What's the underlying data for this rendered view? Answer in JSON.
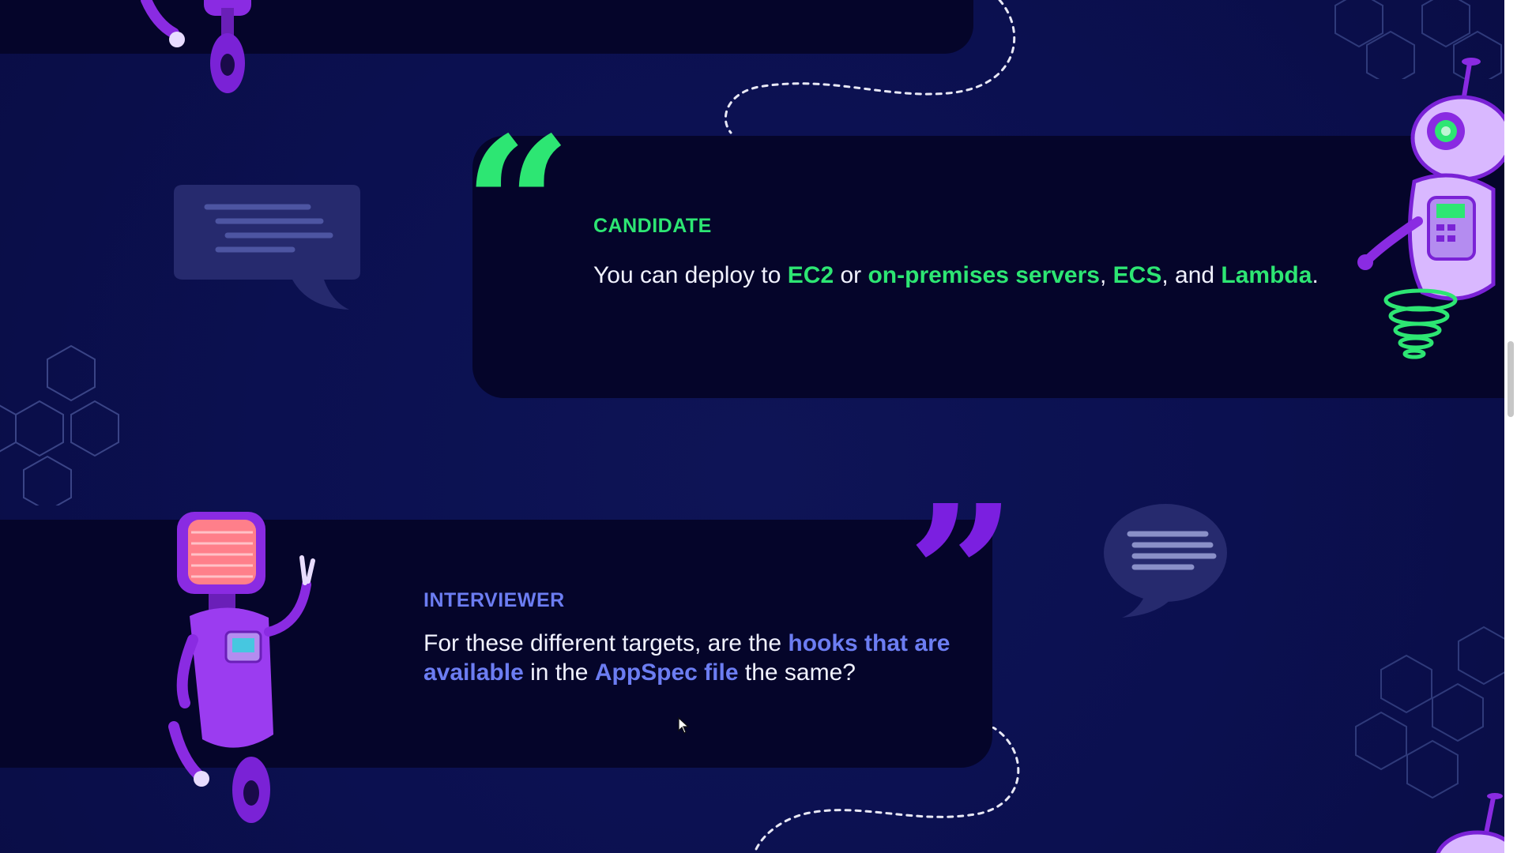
{
  "conversation": {
    "candidate": {
      "role_label": "CANDIDATE",
      "message": {
        "t1": "You can deploy to ",
        "h1": "EC2",
        "t2": " or ",
        "h2": "on-premises servers",
        "t3": ", ",
        "h3": "ECS",
        "t4": ", and ",
        "h4": "Lambda",
        "t5": "."
      }
    },
    "interviewer": {
      "role_label": "INTERVIEWER",
      "message": {
        "t1": "For these different targets, are the ",
        "h1": "hooks that are available",
        "t2": " in the ",
        "h2": "AppSpec file",
        "t3": " the same?"
      }
    }
  },
  "quotes": {
    "open": "“",
    "close": "”"
  },
  "colors": {
    "background": "#0b1050",
    "card": "#05052a",
    "candidate_accent": "#2de673",
    "interviewer_accent": "#6c7df2",
    "robot_purple": "#8a2be2",
    "text": "#f1f2ff"
  },
  "icons": [
    "robot-illustration",
    "chat-bubble-icon",
    "hexagon-pattern",
    "dashed-path",
    "mouse-cursor-icon"
  ]
}
